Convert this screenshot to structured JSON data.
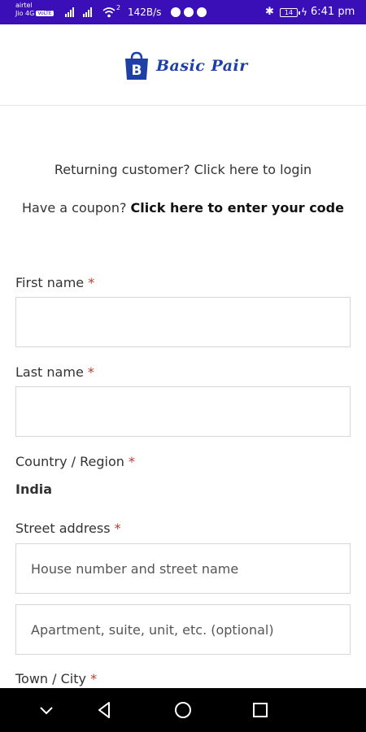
{
  "status_bar": {
    "carrier_1": "airtel",
    "carrier_2": "Jio 4G",
    "volte": "VoLTE",
    "wifi_label": "2",
    "speed": "142B/s",
    "battery": "14",
    "time": "6:41 pm"
  },
  "header": {
    "brand": "Basic Pair",
    "logo_letter": "B"
  },
  "links": {
    "returning": "Returning customer? Click here to login",
    "coupon_prefix": "Have a coupon?",
    "coupon_link": "Click here to enter your code"
  },
  "form": {
    "first_name_label": "First name",
    "last_name_label": "Last name",
    "country_label": "Country / Region",
    "country_value": "India",
    "street_label": "Street address",
    "street_placeholder": "House number and street name",
    "apartment_placeholder": "Apartment, suite, unit, etc. (optional)",
    "town_label": "Town / City",
    "required_mark": "*"
  }
}
